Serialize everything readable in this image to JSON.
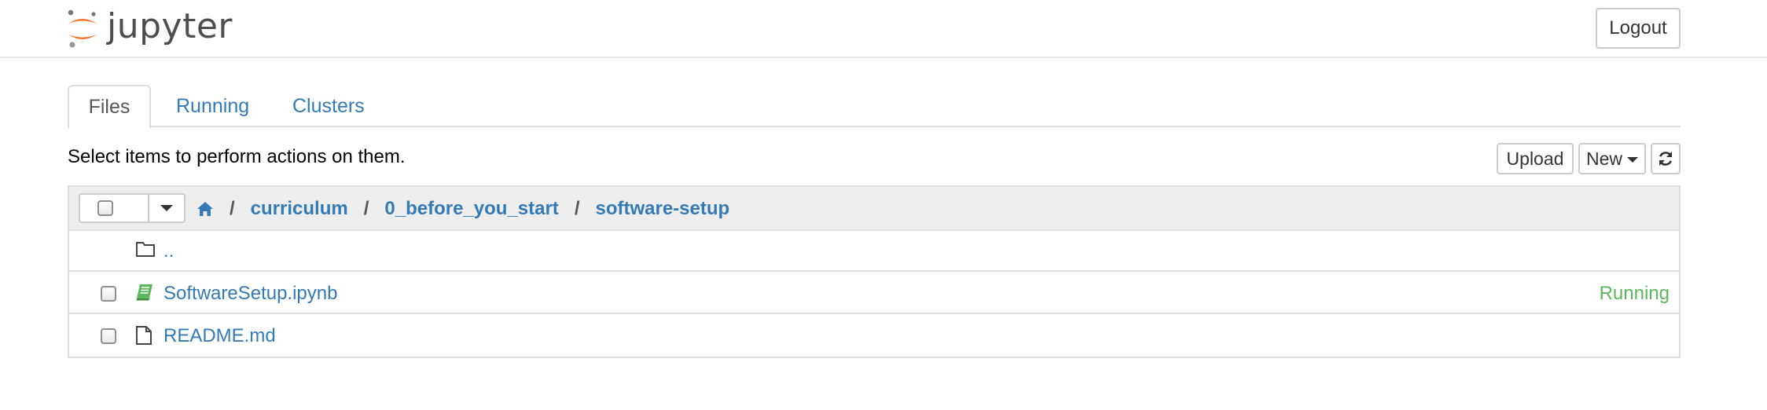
{
  "header": {
    "logo_text": "jupyter",
    "logout_label": "Logout"
  },
  "tabs": [
    {
      "label": "Files",
      "active": true
    },
    {
      "label": "Running",
      "active": false
    },
    {
      "label": "Clusters",
      "active": false
    }
  ],
  "toolbar": {
    "hint": "Select items to perform actions on them.",
    "upload_label": "Upload",
    "new_label": "New",
    "refresh_icon": "refresh-icon"
  },
  "breadcrumb": {
    "home_icon": "home-icon",
    "separator": "/",
    "items": [
      "curriculum",
      "0_before_you_start",
      "software-setup"
    ]
  },
  "files": [
    {
      "name": "..",
      "type": "folder",
      "status": ""
    },
    {
      "name": "SoftwareSetup.ipynb",
      "type": "notebook",
      "status": "Running"
    },
    {
      "name": "README.md",
      "type": "file",
      "status": ""
    }
  ],
  "colors": {
    "link": "#337ab7",
    "running": "#5cb85c",
    "logo_orange": "#f37726"
  }
}
